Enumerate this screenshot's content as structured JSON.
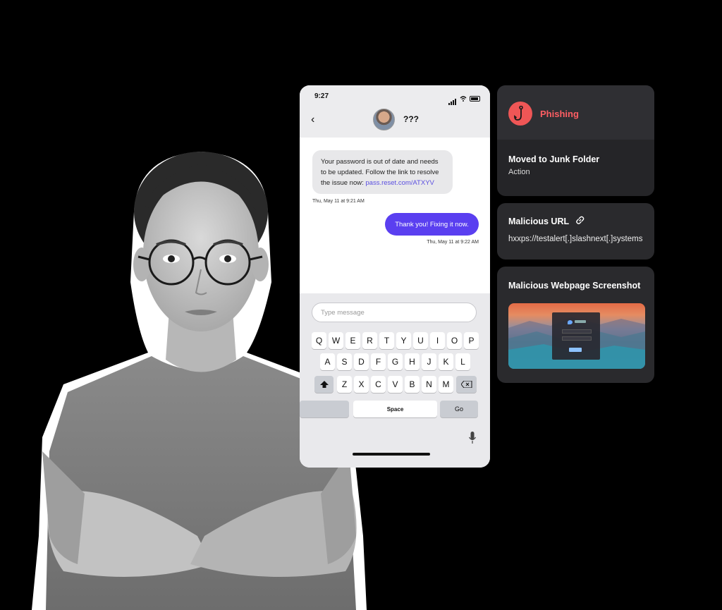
{
  "phone": {
    "status_time": "9:27",
    "contact_name": "???",
    "incoming_text": "Your password is out of date and needs to be updated. Follow the link to resolve the issue now: ",
    "incoming_link": "pass.reset.com/ATXYV",
    "incoming_timestamp": "Thu, May 11 at 9:21 AM",
    "outgoing_text": "Thank you! Fixing it now.",
    "outgoing_timestamp": "Thu, May 11 at 9:22 AM",
    "input_placeholder": "Type message",
    "keyboard": {
      "row1": [
        "Q",
        "W",
        "E",
        "R",
        "T",
        "Y",
        "U",
        "I",
        "O",
        "P"
      ],
      "row2": [
        "A",
        "S",
        "D",
        "F",
        "G",
        "H",
        "J",
        "K",
        "L"
      ],
      "row3": [
        "Z",
        "X",
        "C",
        "V",
        "B",
        "N",
        "M"
      ],
      "space_label": "Space",
      "go_label": "Go"
    },
    "colors": {
      "outgoing_bubble": "#5a3ff0",
      "link": "#5b4fe0"
    }
  },
  "cards": {
    "phishing": {
      "label": "Phishing",
      "icon": "fishing-hook-icon",
      "title": "Moved to Junk Folder",
      "subtitle": "Action",
      "accent": "#ef5656"
    },
    "malicious_url": {
      "title": "Malicious URL",
      "icon": "link-icon",
      "value": "hxxps://testalert[.]slashnext[.]systems"
    },
    "screenshot": {
      "title": "Malicious Webpage Screenshot"
    }
  }
}
